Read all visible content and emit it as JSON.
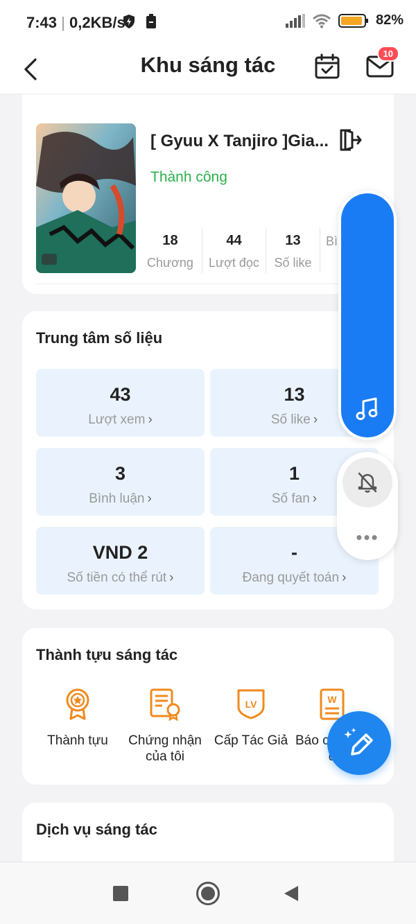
{
  "status_bar": {
    "time": "7:43",
    "separator": "|",
    "speed": "0,2KB/s",
    "battery_percent": "82%"
  },
  "header": {
    "title": "Khu sáng tác",
    "mail_badge": "10",
    "icons": [
      "back-icon",
      "calendar-check-icon",
      "mail-icon"
    ]
  },
  "story": {
    "title": "[ Gyuu X Tanjiro ]Gia...",
    "status": "Thành công",
    "status_color": "#2bb24c",
    "stats": [
      {
        "value": "18",
        "label": "Chương"
      },
      {
        "value": "44",
        "label": "Lượt đọc"
      },
      {
        "value": "13",
        "label": "Số like"
      },
      {
        "value": "",
        "label": "Bìn"
      }
    ]
  },
  "data_center": {
    "title": "Trung tâm số liệu",
    "tiles": [
      {
        "value": "43",
        "label": "Lượt xem"
      },
      {
        "value": "13",
        "label": "Số like"
      },
      {
        "value": "3",
        "label": "Bình luận"
      },
      {
        "value": "1",
        "label": "Số fan"
      },
      {
        "value": "VND 2",
        "label": "Số tiền có thể rút"
      },
      {
        "value": "-",
        "label": "Đang quyết toán"
      }
    ],
    "chevron": "›"
  },
  "achievements": {
    "title": "Thành tựu sáng tác",
    "items": [
      {
        "label_line1": "Thành tựu",
        "label_line2": "",
        "icon": "medal-icon"
      },
      {
        "label_line1": "Chứng nhận",
        "label_line2": "của tôi",
        "icon": "certificate-icon"
      },
      {
        "label_line1": "Cấp Tác Giả",
        "label_line2": "",
        "icon": "level-badge-icon"
      },
      {
        "label_line1": "Báo c",
        "label_line2": "đ",
        "icon": "report-doc-icon"
      }
    ]
  },
  "services": {
    "title": "Dịch vụ sáng tác"
  },
  "floating": {
    "music_icon": "music-note-icon",
    "mute_icon": "bell-off-icon",
    "more_icon": "more-dots-icon",
    "dots": "•••"
  },
  "fab": {
    "icon": "pen-sparkle-icon"
  },
  "colors": {
    "accent_blue": "#1a7cf5",
    "tile_bg": "#eaf3fd",
    "orange": "#f08a1c"
  }
}
